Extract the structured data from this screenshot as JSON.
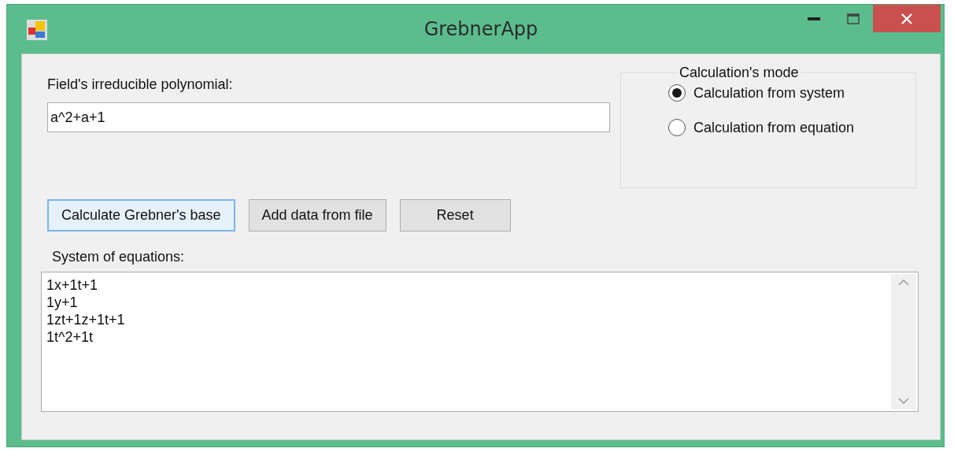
{
  "window": {
    "title": "GrebnerApp"
  },
  "polynomial": {
    "label": "Field's irreducible polynomial:",
    "value": "a^2+a+1"
  },
  "mode": {
    "title": "Calculation's mode",
    "options": [
      {
        "label": "Calculation from system",
        "selected": true
      },
      {
        "label": "Calculation from equation",
        "selected": false
      }
    ]
  },
  "buttons": [
    {
      "label": "Calculate Grebner's base",
      "focused": true
    },
    {
      "label": "Add data from file",
      "focused": false
    },
    {
      "label": "Reset",
      "focused": false
    }
  ],
  "system": {
    "label": "System of equations:",
    "lines": [
      "1x+1t+1",
      "1y+1",
      "1zt+1z+1t+1",
      "1t^2+1t"
    ]
  }
}
